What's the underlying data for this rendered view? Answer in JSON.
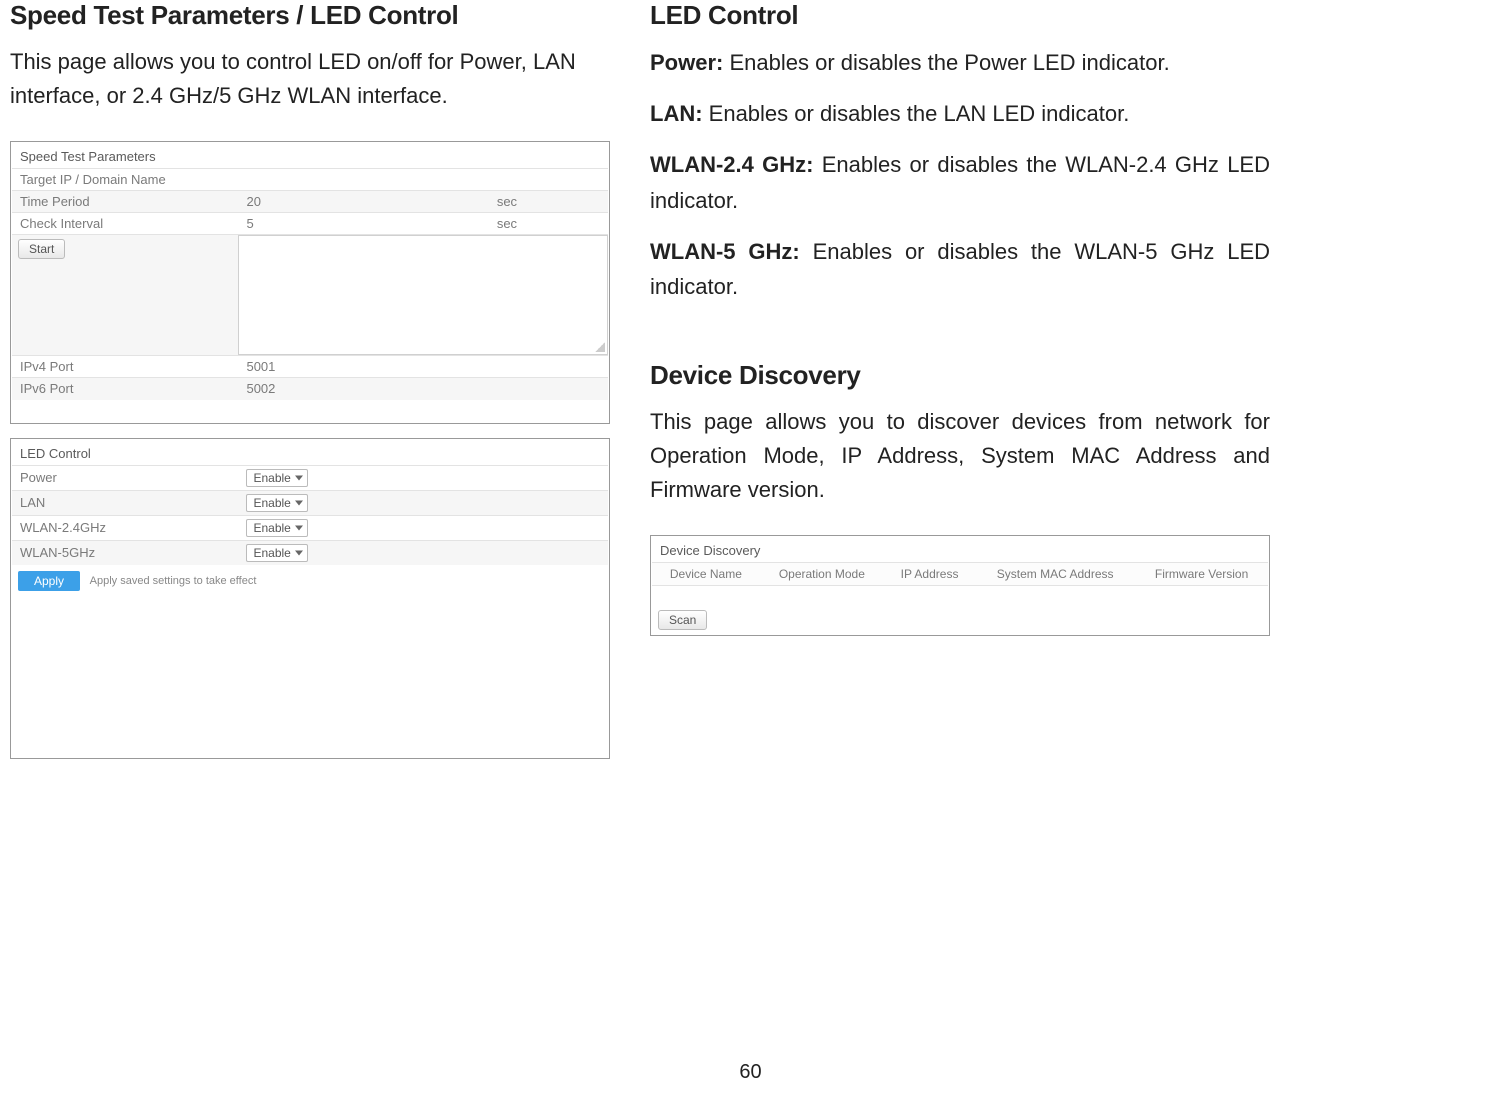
{
  "left": {
    "heading": "Speed Test Parameters / LED Control",
    "intro": "This page allows you to control LED on/off for Power, LAN interface, or 2.4 GHz/5 GHz WLAN interface."
  },
  "speed_panel": {
    "title": "Speed Test Parameters",
    "rows": {
      "target_label": "Target IP / Domain Name",
      "target_value": "",
      "time_label": "Time Period",
      "time_value": "20",
      "time_unit": "sec",
      "check_label": "Check Interval",
      "check_value": "5",
      "check_unit": "sec",
      "ipv4_label": "IPv4 Port",
      "ipv4_value": "5001",
      "ipv6_label": "IPv6 Port",
      "ipv6_value": "5002"
    },
    "start_label": "Start"
  },
  "led_panel": {
    "title": "LED Control",
    "rows": [
      {
        "label": "Power",
        "value": "Enable"
      },
      {
        "label": "LAN",
        "value": "Enable"
      },
      {
        "label": "WLAN-2.4GHz",
        "value": "Enable"
      },
      {
        "label": "WLAN-5GHz",
        "value": "Enable"
      }
    ],
    "apply_label": "Apply",
    "hint": "Apply saved settings to take effect"
  },
  "right": {
    "led_heading": "LED Control",
    "power_bold": "Power:",
    "power_text": " Enables or disables the Power LED indicator.",
    "lan_bold": "LAN:",
    "lan_text": " Enables or disables the LAN LED indicator.",
    "wlan24_bold": "WLAN-2.4 GHz:",
    "wlan24_text": " Enables or disables the WLAN-2.4 GHz LED indicator.",
    "wlan5_bold": "WLAN-5 GHz:",
    "wlan5_text": " Enables or disables the WLAN-5 GHz LED indicator.",
    "dd_heading": "Device Discovery",
    "dd_intro": "This page allows you to discover devices from network for Operation Mode, IP Address, System MAC Address and Firmware version."
  },
  "dd_panel": {
    "title": "Device Discovery",
    "headers": [
      "Device Name",
      "Operation Mode",
      "IP Address",
      "System MAC Address",
      "Firmware Version"
    ],
    "scan_label": "Scan"
  },
  "page_number": "60"
}
